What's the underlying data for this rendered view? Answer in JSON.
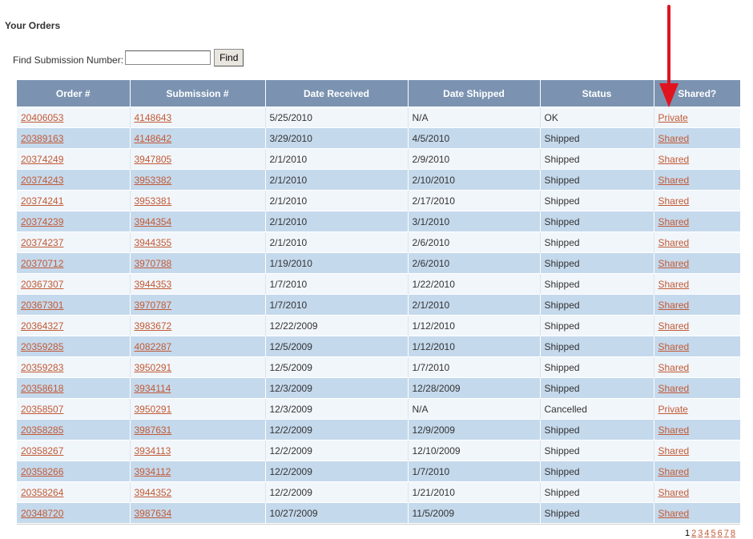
{
  "page": {
    "title": "Your Orders"
  },
  "search": {
    "label": "Find Submission Number:",
    "value": "",
    "placeholder": "",
    "button_label": "Find"
  },
  "table": {
    "headers": [
      "Order #",
      "Submission #",
      "Date Received",
      "Date Shipped",
      "Status",
      "Shared?"
    ],
    "rows": [
      [
        "20406053",
        "4148643",
        "5/25/2010",
        "N/A",
        "OK",
        "Private"
      ],
      [
        "20389163",
        "4148642",
        "3/29/2010",
        "4/5/2010",
        "Shipped",
        "Shared"
      ],
      [
        "20374249",
        "3947805",
        "2/1/2010",
        "2/9/2010",
        "Shipped",
        "Shared"
      ],
      [
        "20374243",
        "3953382",
        "2/1/2010",
        "2/10/2010",
        "Shipped",
        "Shared"
      ],
      [
        "20374241",
        "3953381",
        "2/1/2010",
        "2/17/2010",
        "Shipped",
        "Shared"
      ],
      [
        "20374239",
        "3944354",
        "2/1/2010",
        "3/1/2010",
        "Shipped",
        "Shared"
      ],
      [
        "20374237",
        "3944355",
        "2/1/2010",
        "2/6/2010",
        "Shipped",
        "Shared"
      ],
      [
        "20370712",
        "3970788",
        "1/19/2010",
        "2/6/2010",
        "Shipped",
        "Shared"
      ],
      [
        "20367307",
        "3944353",
        "1/7/2010",
        "1/22/2010",
        "Shipped",
        "Shared"
      ],
      [
        "20367301",
        "3970787",
        "1/7/2010",
        "2/1/2010",
        "Shipped",
        "Shared"
      ],
      [
        "20364327",
        "3983672",
        "12/22/2009",
        "1/12/2010",
        "Shipped",
        "Shared"
      ],
      [
        "20359285",
        "4082287",
        "12/5/2009",
        "1/12/2010",
        "Shipped",
        "Shared"
      ],
      [
        "20359283",
        "3950291",
        "12/5/2009",
        "1/7/2010",
        "Shipped",
        "Shared"
      ],
      [
        "20358618",
        "3934114",
        "12/3/2009",
        "12/28/2009",
        "Shipped",
        "Shared"
      ],
      [
        "20358507",
        "3950291",
        "12/3/2009",
        "N/A",
        "Cancelled",
        "Private"
      ],
      [
        "20358285",
        "3987631",
        "12/2/2009",
        "12/9/2009",
        "Shipped",
        "Shared"
      ],
      [
        "20358267",
        "3934113",
        "12/2/2009",
        "12/10/2009",
        "Shipped",
        "Shared"
      ],
      [
        "20358266",
        "3934112",
        "12/2/2009",
        "1/7/2010",
        "Shipped",
        "Shared"
      ],
      [
        "20358264",
        "3944352",
        "12/2/2009",
        "1/21/2010",
        "Shipped",
        "Shared"
      ],
      [
        "20348720",
        "3987634",
        "10/27/2009",
        "11/5/2009",
        "Shipped",
        "Shared"
      ]
    ]
  },
  "pagination": {
    "current": "1",
    "pages": [
      "2",
      "3",
      "4",
      "5",
      "6",
      "7",
      "8"
    ]
  },
  "annotation": {
    "icon": "red-arrow-icon",
    "color": "#e0141e"
  },
  "colors": {
    "header_bg": "#7b93b1",
    "row_odd": "#f1f6fb",
    "row_even": "#c5d9ec",
    "link": "#c25a35"
  }
}
